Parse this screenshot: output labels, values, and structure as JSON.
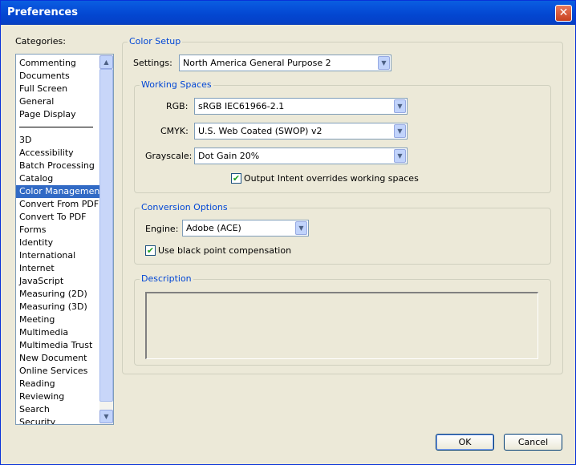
{
  "window": {
    "title": "Preferences",
    "close_glyph": "✕"
  },
  "categories": {
    "label": "Categories:",
    "group1": [
      "Commenting",
      "Documents",
      "Full Screen",
      "General",
      "Page Display"
    ],
    "group2": [
      "3D",
      "Accessibility",
      "Batch Processing",
      "Catalog",
      "Color Management",
      "Convert From PDF",
      "Convert To PDF",
      "Forms",
      "Identity",
      "International",
      "Internet",
      "JavaScript",
      "Measuring (2D)",
      "Measuring (3D)",
      "Meeting",
      "Multimedia",
      "Multimedia Trust",
      "New Document",
      "Online Services",
      "Reading",
      "Reviewing",
      "Search",
      "Security"
    ],
    "selected": "Color Management"
  },
  "color_setup": {
    "title": "Color Setup",
    "settings_label": "Settings:",
    "settings_value": "North America General Purpose 2"
  },
  "working_spaces": {
    "title": "Working Spaces",
    "rgb_label": "RGB:",
    "rgb_value": "sRGB IEC61966-2.1",
    "cmyk_label": "CMYK:",
    "cmyk_value": "U.S. Web Coated (SWOP) v2",
    "grayscale_label": "Grayscale:",
    "grayscale_value": "Dot Gain 20%",
    "output_intent_label": "Output Intent overrides working spaces",
    "output_intent_checked": true
  },
  "conversion": {
    "title": "Conversion Options",
    "engine_label": "Engine:",
    "engine_value": "Adobe (ACE)",
    "black_point_label": "Use black point compensation",
    "black_point_checked": true
  },
  "description": {
    "title": "Description"
  },
  "buttons": {
    "ok": "OK",
    "cancel": "Cancel"
  },
  "icons": {
    "check": "✔",
    "arrow_down": "▼",
    "arrow_up": "▲"
  },
  "colors": {
    "accent": "#0046d5",
    "selection": "#316ac5",
    "titlebar": "#0855dd"
  }
}
